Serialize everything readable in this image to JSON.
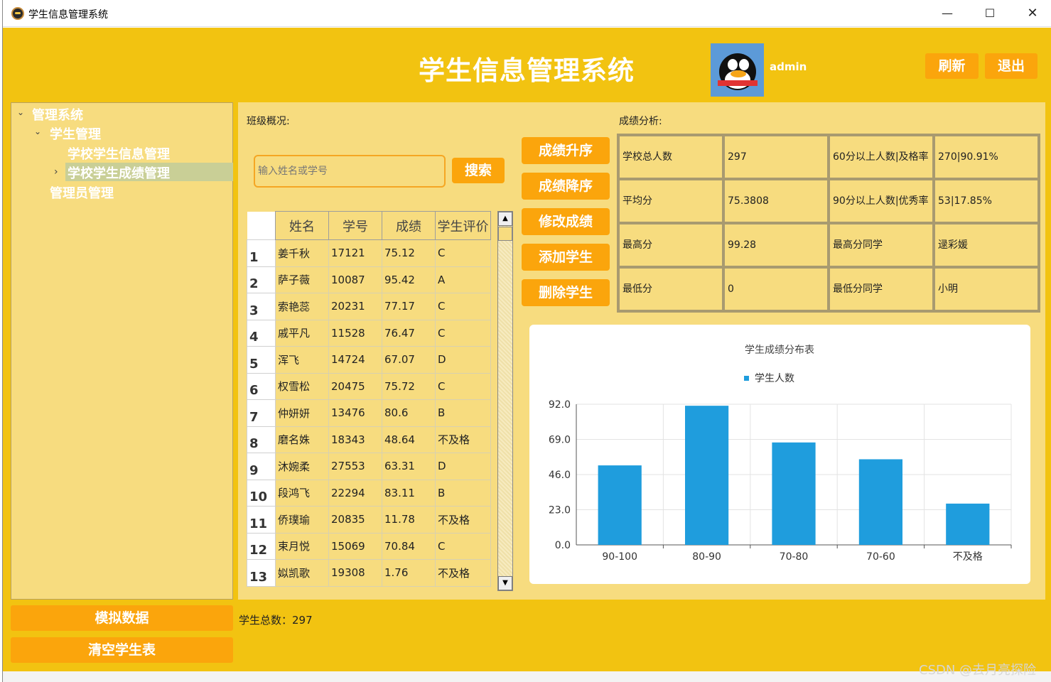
{
  "window": {
    "title": "学生信息管理系统",
    "min_glyph": "—",
    "max_glyph": "☐",
    "close_glyph": "✕"
  },
  "header": {
    "title": "学生信息管理系统",
    "user": "admin",
    "refresh_label": "刷新",
    "exit_label": "退出"
  },
  "tree": {
    "root": "管理系统",
    "student_mgmt": "学生管理",
    "student_info": "学校学生信息管理",
    "student_score": "学校学生成绩管理",
    "admin_mgmt": "管理员管理"
  },
  "sidebar_buttons": {
    "simulate": "模拟数据",
    "clear": "清空学生表"
  },
  "class_overview_label": "班级概况:",
  "score_analysis_label": "成绩分析:",
  "search": {
    "placeholder": "输入姓名或学号",
    "button": "搜索"
  },
  "table": {
    "columns": [
      "姓名",
      "学号",
      "成绩",
      "学生评价"
    ],
    "rows": [
      [
        "1",
        "姜千秋",
        "17121",
        "75.12",
        "C"
      ],
      [
        "2",
        "萨子薇",
        "10087",
        "95.42",
        "A"
      ],
      [
        "3",
        "索艳蕊",
        "20231",
        "77.17",
        "C"
      ],
      [
        "4",
        "戚平凡",
        "11528",
        "76.47",
        "C"
      ],
      [
        "5",
        "浑飞",
        "14724",
        "67.07",
        "D"
      ],
      [
        "6",
        "权雪松",
        "20475",
        "75.72",
        "C"
      ],
      [
        "7",
        "仲妍妍",
        "13476",
        "80.6",
        "B"
      ],
      [
        "8",
        "磨名姝",
        "18343",
        "48.64",
        "不及格"
      ],
      [
        "9",
        "沐婉柔",
        "27553",
        "63.31",
        "D"
      ],
      [
        "10",
        "段鸿飞",
        "22294",
        "83.11",
        "B"
      ],
      [
        "11",
        "侨璞瑜",
        "20835",
        "11.78",
        "不及格"
      ],
      [
        "12",
        "束月悦",
        "15069",
        "70.84",
        "C"
      ],
      [
        "13",
        "姒凯歌",
        "19308",
        "1.76",
        "不及格"
      ]
    ]
  },
  "actions": {
    "asc": "成绩升序",
    "desc": "成绩降序",
    "edit": "修改成绩",
    "add": "添加学生",
    "delete": "删除学生"
  },
  "stats": {
    "total_label": "学校总人数",
    "total": "297",
    "pass_label": "60分以上人数|及格率",
    "pass": "270|90.91%",
    "avg_label": "平均分",
    "avg": "75.3808",
    "excellent_label": "90分以上人数|优秀率",
    "excellent": "53|17.85%",
    "max_label": "最高分",
    "max": "99.28",
    "max_student_label": "最高分同学",
    "max_student": "逯彩媛",
    "min_label": "最低分",
    "min": "0",
    "min_student_label": "最低分同学",
    "min_student": "小明"
  },
  "footer": {
    "total_students": "学生总数：297",
    "watermark": "CSDN @去月亮探险"
  },
  "colors": {
    "background": "#f2c311",
    "panel": "#f7dc7f",
    "button": "#fba50c",
    "bar": "#1f9ddd",
    "selected": "#c9cf96"
  },
  "chart_data": {
    "type": "bar",
    "title": "学生成绩分布表",
    "legend": [
      "学生人数"
    ],
    "legend_position": "top",
    "categories": [
      "90-100",
      "80-90",
      "70-80",
      "70-60",
      "不及格"
    ],
    "series": [
      {
        "name": "学生人数",
        "values": [
          52,
          91,
          67,
          56,
          27
        ]
      }
    ],
    "yticks": [
      "0.0",
      "23.0",
      "46.0",
      "69.0",
      "92.0"
    ],
    "ylim": [
      0,
      92
    ],
    "grid": true
  }
}
